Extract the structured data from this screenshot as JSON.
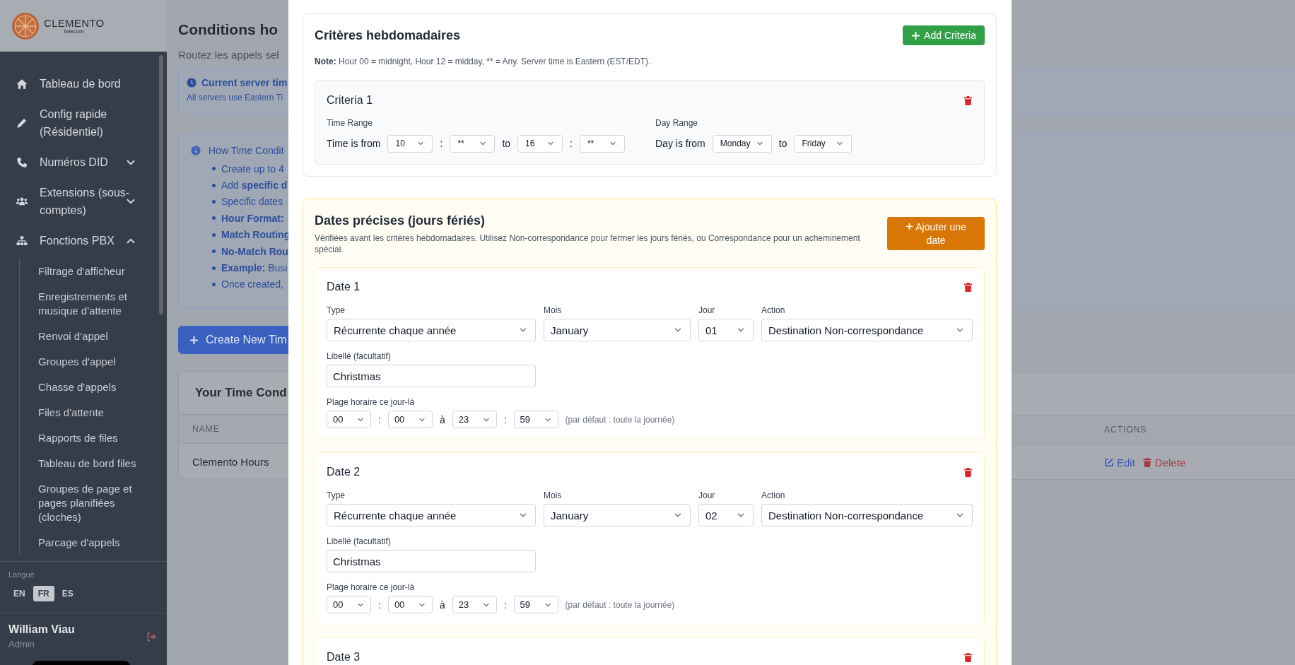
{
  "sidebar": {
    "logo": {
      "name": "CLEMENTO",
      "tagline": "telecom"
    },
    "nav": [
      {
        "label": "Tableau de bord"
      },
      {
        "label": "Config rapide (Résidentiel)"
      },
      {
        "label": "Numéros DID",
        "expanded": false
      },
      {
        "label": "Extensions (sous-comptes)",
        "expanded": false
      },
      {
        "label": "Fonctions PBX",
        "expanded": true
      }
    ],
    "subnav": [
      "Filtrage d'afficheur",
      "Enregistrements et musique d'attente",
      "Renvoi d'appel",
      "Groupes d'appel",
      "Chasse d'appels",
      "Files d'attente",
      "Rapports de files",
      "Tableau de bord files",
      "Groupes de page et pages planifiées (cloches)",
      "Parcage d'appels"
    ],
    "language": {
      "label": "Langue",
      "options": [
        {
          "label": "EN",
          "selected": false
        },
        {
          "label": "FR",
          "selected": true
        },
        {
          "label": "ES",
          "selected": false
        }
      ]
    },
    "user": {
      "name": "William Viau",
      "role": "Admin"
    }
  },
  "background_page": {
    "title": "Conditions ho",
    "subtitle": "Routez les appels sel",
    "server_time": {
      "title": "Current server tim",
      "note": "All servers use Eastern Ti"
    },
    "how_to": {
      "title": "How Time Condit",
      "items": [
        "Create up to 4",
        "Add **specific d**",
        "Specific dates",
        "**Hour Format:**",
        "**Match Routing**",
        "**No-Match Rou**",
        "**Example:** Busi",
        "Once created,"
      ]
    },
    "create_button": "Create New Tim",
    "table": {
      "title": "Your Time Cond",
      "columns": [
        "NAME",
        "ACTIONS"
      ],
      "rows": [
        {
          "name": "Clemento Hours",
          "actions": [
            "Edit",
            "Delete"
          ]
        }
      ]
    }
  },
  "modal": {
    "weekly": {
      "title": "Critères hebdomadaires",
      "add_button": "Add Criteria",
      "note": {
        "label": "Note:",
        "text": "Hour 00 = midnight, Hour 12 = midday, ** = Any. Server time is Eastern (EST/EDT)."
      },
      "criteria": [
        {
          "title": "Criteria 1",
          "time_label": "Time Range",
          "time_prefix": "Time is from",
          "from_hour": "10",
          "from_sep": ":",
          "from_minute": "**",
          "to_word": "to",
          "to_hour": "16",
          "to_sep": ":",
          "to_minute": "**",
          "day_label": "Day Range",
          "day_prefix": "Day is from",
          "from_day": "Monday",
          "day_to_word": "to",
          "to_day": "Friday"
        }
      ]
    },
    "dates": {
      "title": "Dates précises (jours fériés)",
      "description": "Vérifiées avant les critères hebdomadaires. Utilisez Non-correspondance pour fermer les jours fériés, ou Correspondance pour un acheminement spécial.",
      "add_button": "Ajouter une date",
      "items": [
        {
          "title": "Date 1",
          "type_label": "Type",
          "type": "Récurrente chaque année",
          "month_label": "Mois",
          "month": "January",
          "day_label": "Jour",
          "day": "01",
          "action_label": "Action",
          "action": "Destination Non-correspondance",
          "name_label": "Libellé (facultatif)",
          "name": "Christmas",
          "time_label": "Plage horaire ce jour-là",
          "start_hour": "00",
          "start_sep": ":",
          "start_minute": "00",
          "to_word": "à",
          "end_hour": "23",
          "end_sep": ":",
          "end_minute": "59",
          "hint": "(par défaut : toute la journée)"
        },
        {
          "title": "Date 2",
          "type_label": "Type",
          "type": "Récurrente chaque année",
          "month_label": "Mois",
          "month": "January",
          "day_label": "Jour",
          "day": "02",
          "action_label": "Action",
          "action": "Destination Non-correspondance",
          "name_label": "Libellé (facultatif)",
          "name": "Christmas",
          "time_label": "Plage horaire ce jour-là",
          "start_hour": "00",
          "start_sep": ":",
          "start_minute": "00",
          "to_word": "à",
          "end_hour": "23",
          "end_sep": ":",
          "end_minute": "59",
          "hint": "(par défaut : toute la journée)"
        },
        {
          "title": "Date 3"
        }
      ]
    }
  }
}
